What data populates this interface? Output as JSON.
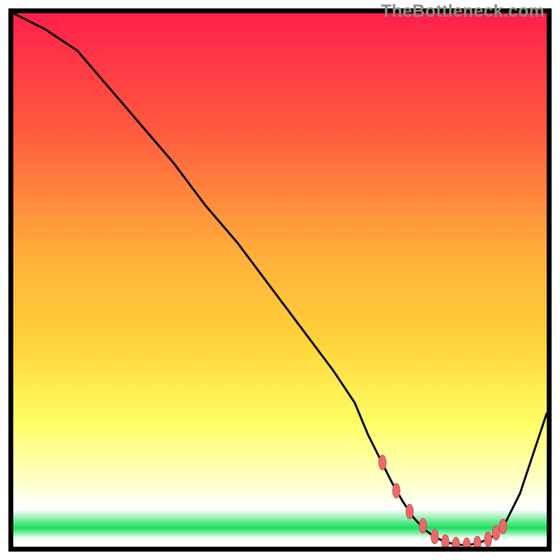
{
  "watermark": "TheBottleneck.com",
  "colors": {
    "gradient_top": "#ff1f4b",
    "gradient_mid1": "#ff7a3a",
    "gradient_mid2": "#ffd43a",
    "gradient_low": "#ffff66",
    "gradient_paleyellow": "#ffffcc",
    "gradient_white": "#ffffff",
    "gradient_green": "#18e05b",
    "curve": "#000000",
    "marker_fill": "#e96a6a",
    "marker_stroke": "#c94f4f"
  },
  "chart_data": {
    "type": "line",
    "title": "",
    "xlabel": "",
    "ylabel": "",
    "xlim": [
      0,
      100
    ],
    "ylim": [
      0,
      100
    ],
    "x": [
      0,
      6,
      12,
      18,
      24,
      30,
      36,
      42,
      48,
      54,
      60,
      64,
      66.5,
      69,
      71,
      73,
      75,
      77,
      79,
      81,
      83,
      85,
      87,
      89.5,
      92,
      95,
      100
    ],
    "values": [
      100,
      97,
      93,
      86,
      79,
      72,
      64,
      57,
      49,
      41,
      33,
      27,
      21,
      16,
      12,
      8.5,
      5.5,
      3.3,
      1.8,
      0.9,
      0.4,
      0.3,
      0.6,
      1.6,
      4,
      10,
      25
    ],
    "optimum_band": {
      "x_start": 69,
      "x_end": 92
    },
    "markers_x": [
      69.2,
      71.8,
      74.3,
      76.8,
      79.0,
      81.0,
      83.0,
      85.0,
      87.0,
      89.0,
      90.5,
      91.8
    ],
    "markers_y": [
      15.8,
      10.5,
      6.6,
      3.9,
      1.9,
      0.9,
      0.4,
      0.3,
      0.6,
      1.4,
      2.6,
      3.8
    ]
  }
}
